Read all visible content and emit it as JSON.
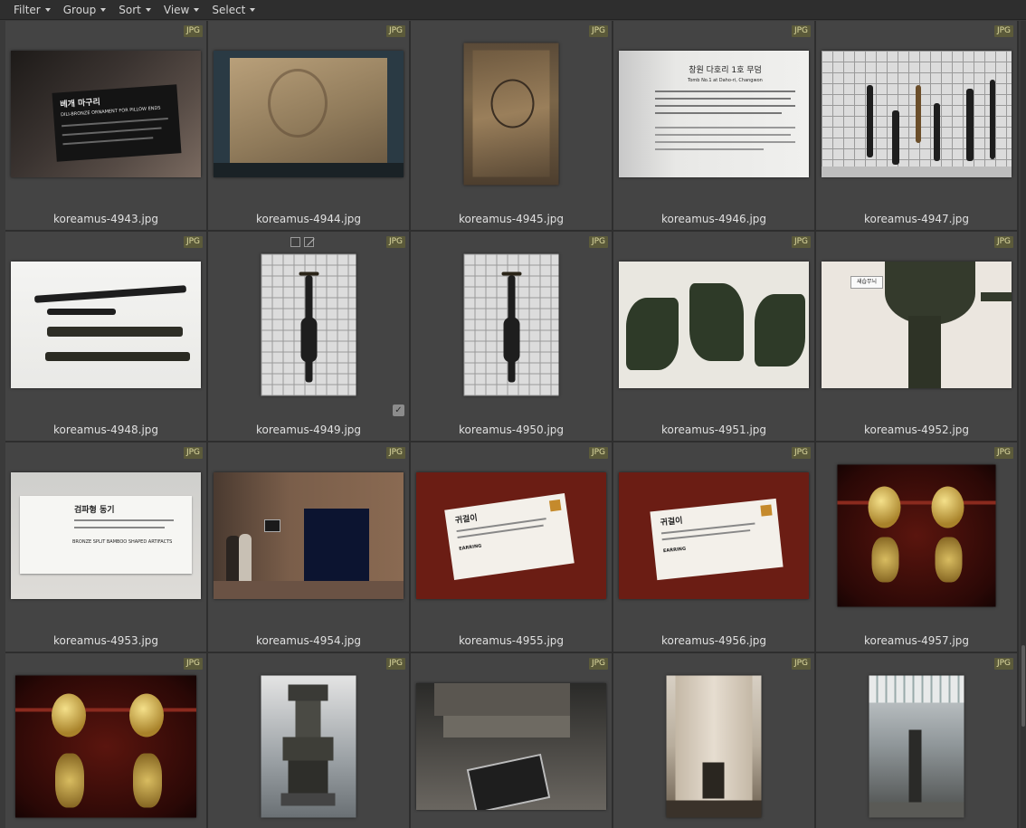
{
  "toolbar": {
    "menus": [
      "Filter",
      "Group",
      "Sort",
      "View",
      "Select"
    ]
  },
  "colors": {
    "background": "#3a3a3a",
    "cell": "#444444",
    "badge_bg": "#5b5a3a",
    "badge_text": "#e0dca2"
  },
  "thumbnails": [
    {
      "file": "koreamus-4943.jpg",
      "badge": "JPG",
      "sign_title": "베개 마구리",
      "sign_subtitle": "DILI-BRONZE ORNAMENT FOR PILLOW ENDS"
    },
    {
      "file": "koreamus-4944.jpg",
      "badge": "JPG"
    },
    {
      "file": "koreamus-4945.jpg",
      "badge": "JPG"
    },
    {
      "file": "koreamus-4946.jpg",
      "badge": "JPG",
      "sign_title": "창원 다호리 1호 무덤",
      "sign_subtitle": "Tomb No.1 at Daho-ri, Changwon"
    },
    {
      "file": "koreamus-4947.jpg",
      "badge": "JPG"
    },
    {
      "file": "koreamus-4948.jpg",
      "badge": "JPG"
    },
    {
      "file": "koreamus-4949.jpg",
      "badge": "JPG",
      "checked": true
    },
    {
      "file": "koreamus-4950.jpg",
      "badge": "JPG"
    },
    {
      "file": "koreamus-4951.jpg",
      "badge": "JPG"
    },
    {
      "file": "koreamus-4952.jpg",
      "badge": "JPG",
      "sign_title": "새습무늬"
    },
    {
      "file": "koreamus-4953.jpg",
      "badge": "JPG",
      "sign_title": "검파형 동기",
      "sign_subtitle": "BRONZE SPLIT BAMBOO SHAPED ARTIFACTS"
    },
    {
      "file": "koreamus-4954.jpg",
      "badge": "JPG"
    },
    {
      "file": "koreamus-4955.jpg",
      "badge": "JPG",
      "sign_title": "귀걸이",
      "sign_subtitle": "EARRING"
    },
    {
      "file": "koreamus-4956.jpg",
      "badge": "JPG",
      "sign_title": "귀걸이",
      "sign_subtitle": "EARRING"
    },
    {
      "file": "koreamus-4957.jpg",
      "badge": "JPG"
    },
    {
      "file": "",
      "badge": "JPG"
    },
    {
      "file": "",
      "badge": "JPG"
    },
    {
      "file": "",
      "badge": "JPG"
    },
    {
      "file": "",
      "badge": "JPG"
    },
    {
      "file": "",
      "badge": "JPG"
    }
  ],
  "icons": {
    "menu_caret": "chevron-down-icon",
    "checkmark": "check-icon",
    "select_box": "checkbox-icon",
    "reject": "reject-icon"
  }
}
